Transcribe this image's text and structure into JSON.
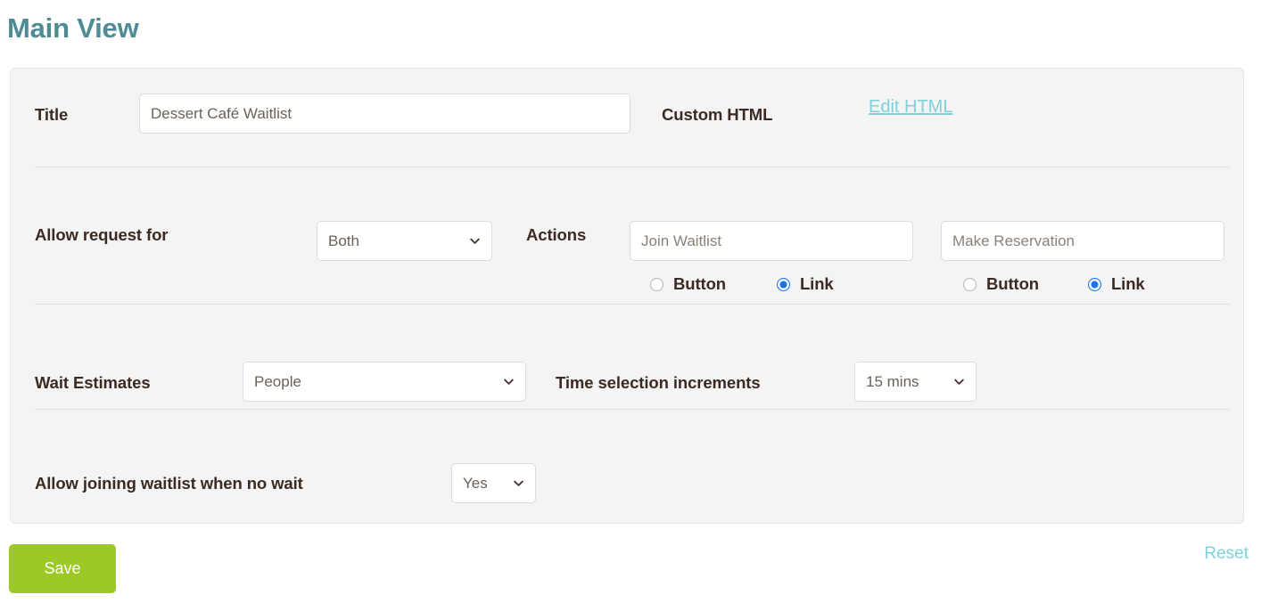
{
  "page": {
    "title": "Main View",
    "heading_color": "#4e8b95"
  },
  "form": {
    "title_row": {
      "label": "Title",
      "input_value": "Dessert Café Waitlist",
      "custom_html_label": "Custom HTML",
      "edit_html_link": "Edit HTML"
    },
    "request_row": {
      "label": "Allow request for",
      "select_value": "Both",
      "actions_label": "Actions",
      "action_one": {
        "placeholder": "Join Waitlist",
        "option_button": "Button",
        "option_link": "Link",
        "selected": "Link"
      },
      "action_two": {
        "placeholder": "Make Reservation",
        "option_button": "Button",
        "option_link": "Link",
        "selected": "Link"
      }
    },
    "estimates_row": {
      "label": "Wait Estimates",
      "select_value": "People",
      "increments_label": "Time selection increments",
      "increments_value": "15 mins"
    },
    "nowait_row": {
      "label": "Allow joining waitlist when no wait",
      "select_value": "Yes"
    }
  },
  "footer": {
    "save_label": "Save",
    "reset_label": "Reset",
    "save_color": "#9dc928",
    "link_color": "#7fd0dc"
  }
}
